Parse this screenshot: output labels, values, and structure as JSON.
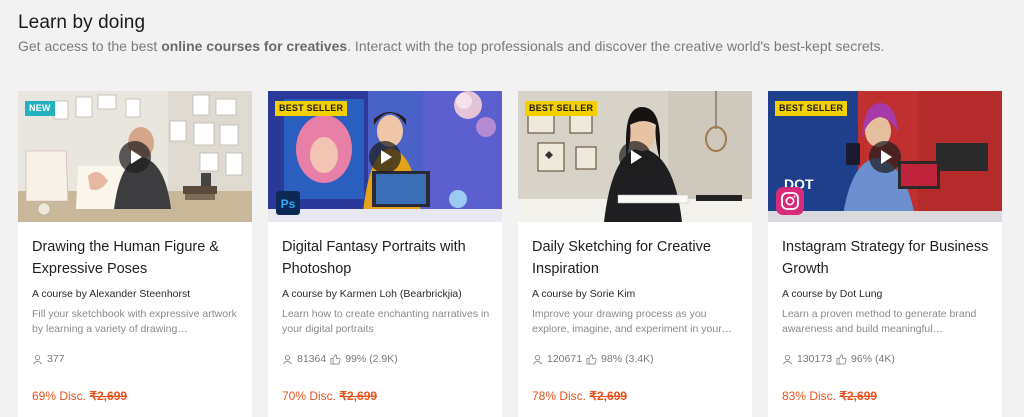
{
  "section": {
    "title": "Learn by doing",
    "subtitle_pre": "Get access to the best ",
    "subtitle_bold": "online courses for creatives",
    "subtitle_post": ". Interact with the top professionals and discover the creative world's best-kept secrets."
  },
  "colors": {
    "accent": "#e8531d",
    "badge_new": "#23b2bd",
    "badge_best": "#f5d000"
  },
  "courses": [
    {
      "badge": "NEW",
      "title": "Drawing the Human Figure & Expressive Poses",
      "author": "A course by Alexander Steenhorst",
      "description": "Fill your sketchbook with expressive artwork by learning a variety of drawing…",
      "students": "377",
      "rating": "",
      "discount": "69% Disc.",
      "price": "₹2,699"
    },
    {
      "badge": "BEST SELLER",
      "title": "Digital Fantasy Portraits with Photoshop",
      "author": "A course by Karmen Loh (Bearbrickjia)",
      "description": "Learn how to create enchanting narratives in your digital portraits",
      "students": "81364",
      "rating": "99% (2.9K)",
      "discount": "70% Disc.",
      "price": "₹2,699",
      "app_icon_label": "Ps"
    },
    {
      "badge": "BEST SELLER",
      "title": "Daily Sketching for Creative Inspiration",
      "author": "A course by Sorie Kim",
      "description": "Improve your drawing process as you explore, imagine, and experiment in your…",
      "students": "120671",
      "rating": "98% (3.4K)",
      "discount": "78% Disc.",
      "price": "₹2,699"
    },
    {
      "badge": "BEST SELLER",
      "title": "Instagram Strategy for Business Growth",
      "author": "A course by Dot Lung",
      "description": "Learn a proven method to generate brand awareness and build meaningful…",
      "students": "130173",
      "rating": "96% (4K)",
      "discount": "83% Disc.",
      "price": "₹2,699",
      "bg_text": "DOT"
    }
  ],
  "icons": {
    "play": "play-icon",
    "students": "user-icon",
    "rating": "thumbs-up-icon",
    "photoshop": "photoshop-icon",
    "instagram": "instagram-icon"
  }
}
